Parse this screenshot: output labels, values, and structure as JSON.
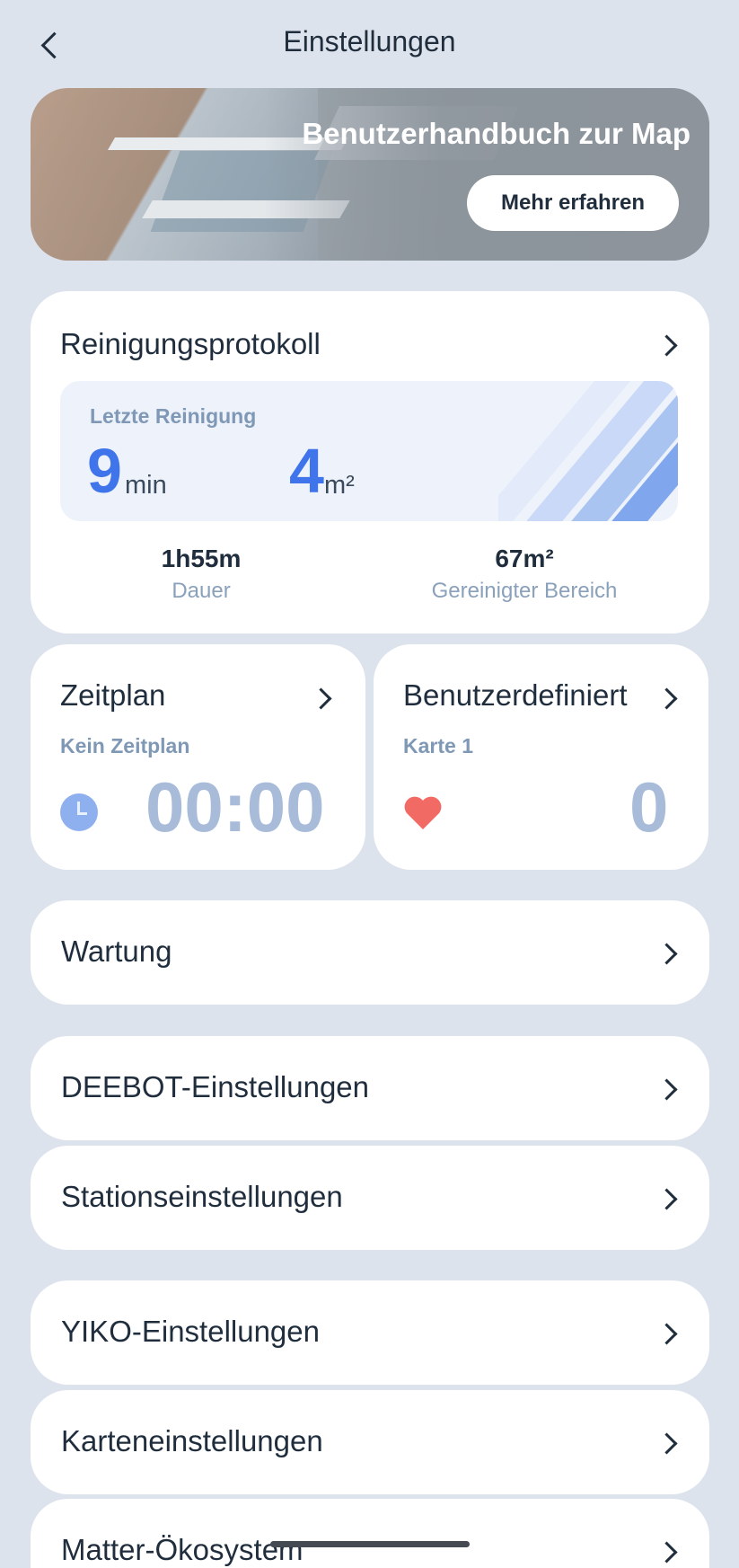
{
  "header": {
    "title": "Einstellungen"
  },
  "banner": {
    "title": "Benutzerhandbuch zur Map",
    "button_label": "Mehr erfahren"
  },
  "protocol": {
    "title": "Reinigungsprotokoll",
    "last_label": "Letzte Reinigung",
    "last_duration_value": "9",
    "last_duration_unit": "min",
    "last_area_value": "4",
    "last_area_unit": "m²",
    "total_duration": "1h55m",
    "total_duration_label": "Dauer",
    "total_area": "67m²",
    "total_area_label": "Gereinigter Bereich"
  },
  "schedule": {
    "title": "Zeitplan",
    "subtitle": "Kein Zeitplan",
    "time": "00:00"
  },
  "custom": {
    "title": "Benutzerdefiniert",
    "subtitle": "Karte 1",
    "count": "0"
  },
  "rows": {
    "maintenance": "Wartung",
    "deebot": "DEEBOT-Einstellungen",
    "station": "Stationseinstellungen",
    "yiko": "YIKO-Einstellungen",
    "map": "Karteneinstellungen",
    "matter": "Matter-Ökosystem"
  },
  "colors": {
    "accent": "#3f74ea",
    "background": "#dde3ec",
    "heart": "#f26a64",
    "muted_number": "#a8bcd9"
  },
  "icons": [
    "back-arrow-icon",
    "chevron-right-icon",
    "clock-icon",
    "heart-icon"
  ]
}
